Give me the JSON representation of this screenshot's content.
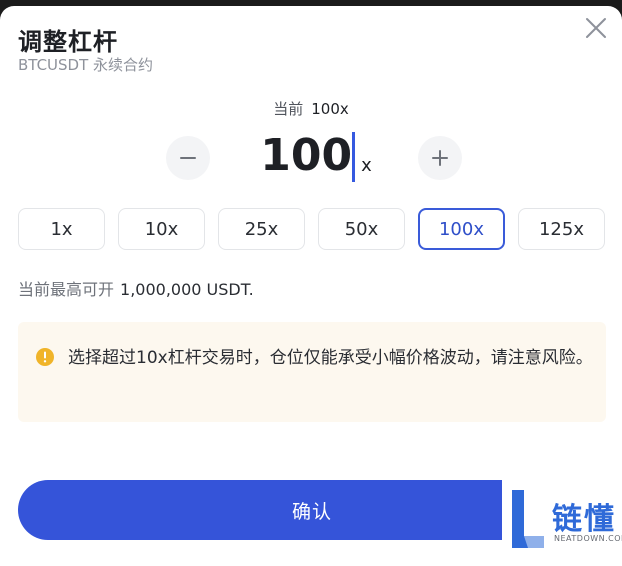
{
  "dialog": {
    "title": "调整杠杆",
    "subtitle": "BTCUSDT 永续合约",
    "close_icon": "close-icon"
  },
  "leverage": {
    "current_label": "当前",
    "current_value": "100x",
    "input_value": "100",
    "unit": "x",
    "minus_icon": "minus-icon",
    "plus_icon": "plus-icon"
  },
  "presets": [
    "1x",
    "10x",
    "25x",
    "50x",
    "100x",
    "125x"
  ],
  "selected_preset": "100x",
  "max_position": {
    "label": "当前最高可开",
    "value": "1,000,000 USDT."
  },
  "warning": {
    "icon": "warning-icon",
    "text": "选择超过10x杠杆交易时，仓位仅能承受小幅价格波动，请注意风险。"
  },
  "confirm_label": "确认",
  "watermark": {
    "name": "链懂",
    "url": "NEATDOWN.COM"
  },
  "colors": {
    "accent": "#3554d9",
    "warning_icon": "#f0b429",
    "warning_bg": "#fdf8ef"
  }
}
